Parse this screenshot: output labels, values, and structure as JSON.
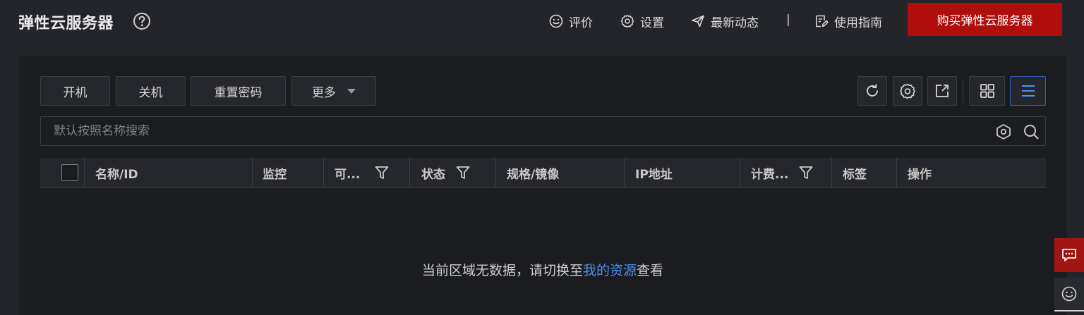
{
  "header": {
    "title": "弹性云服务器",
    "links": [
      {
        "label": "评价",
        "icon": "smile-icon"
      },
      {
        "label": "设置",
        "icon": "gear-icon"
      },
      {
        "label": "最新动态",
        "icon": "paper-plane-icon"
      },
      {
        "label": "使用指南",
        "icon": "guide-icon"
      }
    ],
    "divider": "|",
    "buy_label": "购买弹性云服务器"
  },
  "toolbar": {
    "start_label": "开机",
    "stop_label": "关机",
    "reset_password_label": "重置密码",
    "more_label": "更多"
  },
  "search": {
    "placeholder": "默认按照名称搜索",
    "value": ""
  },
  "table": {
    "columns": [
      "名称/ID",
      "监控",
      "可...",
      "状态",
      "规格/镜像",
      "IP地址",
      "计费...",
      "标签",
      "操作"
    ],
    "rows": []
  },
  "empty_state": {
    "prefix": "当前区域无数据，请切换至",
    "link": "我的资源",
    "suffix": "查看"
  },
  "colors": {
    "background": "#24252a",
    "panel": "#1b1c20",
    "accent_red": "#b00d0d",
    "link_blue": "#4d8ff5",
    "active_border": "#2e5fbf"
  }
}
